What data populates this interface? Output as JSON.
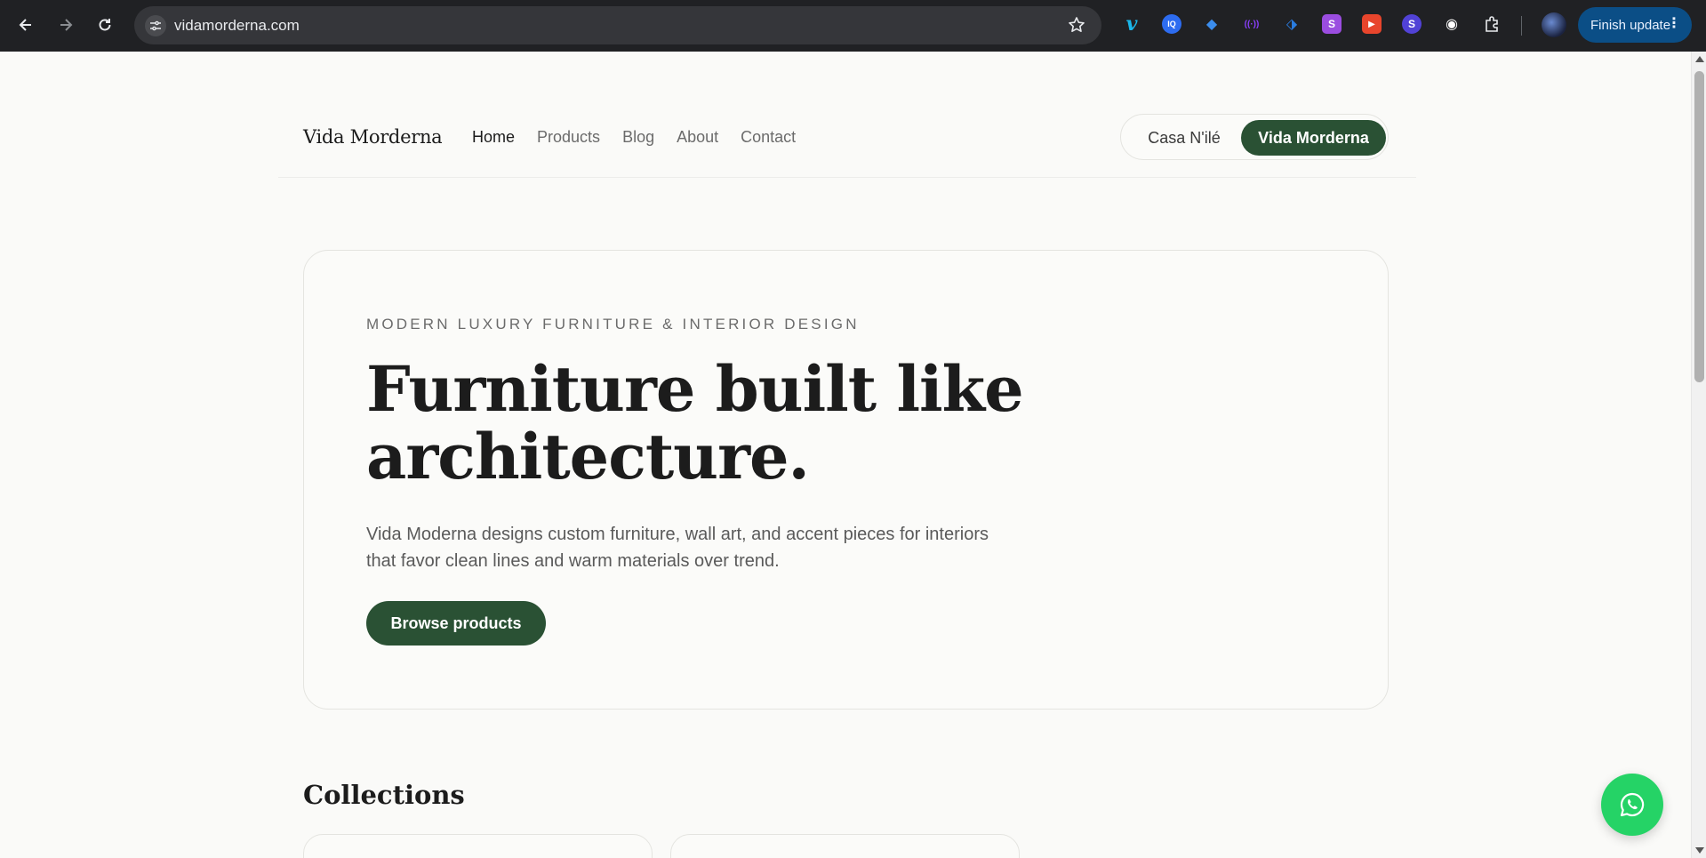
{
  "browser": {
    "url": "vidamorderna.com",
    "finish_update_label": "Finish update",
    "extensions": [
      {
        "name": "vimeo-icon",
        "glyph": "v",
        "color": "#1ab7ea"
      },
      {
        "name": "iq-icon",
        "glyph": "IQ",
        "color": "#2d6cf0"
      },
      {
        "name": "diamond-icon",
        "glyph": "◆",
        "color": "#3b8ded"
      },
      {
        "name": "signal-icon",
        "glyph": "((·))",
        "color": "#8a3ffc"
      },
      {
        "name": "tag-icon",
        "glyph": "⬗",
        "color": "#2a7de1"
      },
      {
        "name": "s-purple-icon",
        "glyph": "S",
        "color": "#9b4de0"
      },
      {
        "name": "slides-icon",
        "glyph": "▶",
        "color": "#e8452c"
      },
      {
        "name": "s-circle-icon",
        "glyph": "S",
        "color": "#5142d6"
      },
      {
        "name": "disc-icon",
        "glyph": "◉",
        "color": "#ffffff"
      },
      {
        "name": "puzzle-icon",
        "glyph": "⧉",
        "color": "#e8eaed"
      }
    ]
  },
  "site": {
    "brand": "Vida Morderna",
    "nav": [
      {
        "label": "Home",
        "active": true
      },
      {
        "label": "Products",
        "active": false
      },
      {
        "label": "Blog",
        "active": false
      },
      {
        "label": "About",
        "active": false
      },
      {
        "label": "Contact",
        "active": false
      }
    ],
    "switcher": {
      "option_1": "Casa N'ilé",
      "option_2": "Vida Morderna",
      "selected": "Vida Morderna"
    },
    "accent_color": "#2a5134"
  },
  "hero": {
    "eyebrow": "MODERN LUXURY FURNITURE & INTERIOR DESIGN",
    "headline": "Furniture built like architecture.",
    "subtitle": "Vida Moderna designs custom furniture, wall art, and accent pieces for interiors that favor clean lines and warm materials over trend.",
    "cta_label": "Browse products"
  },
  "collections": {
    "title": "Collections"
  },
  "floating": {
    "whatsapp_icon": "whatsapp-icon",
    "color": "#25d366"
  }
}
